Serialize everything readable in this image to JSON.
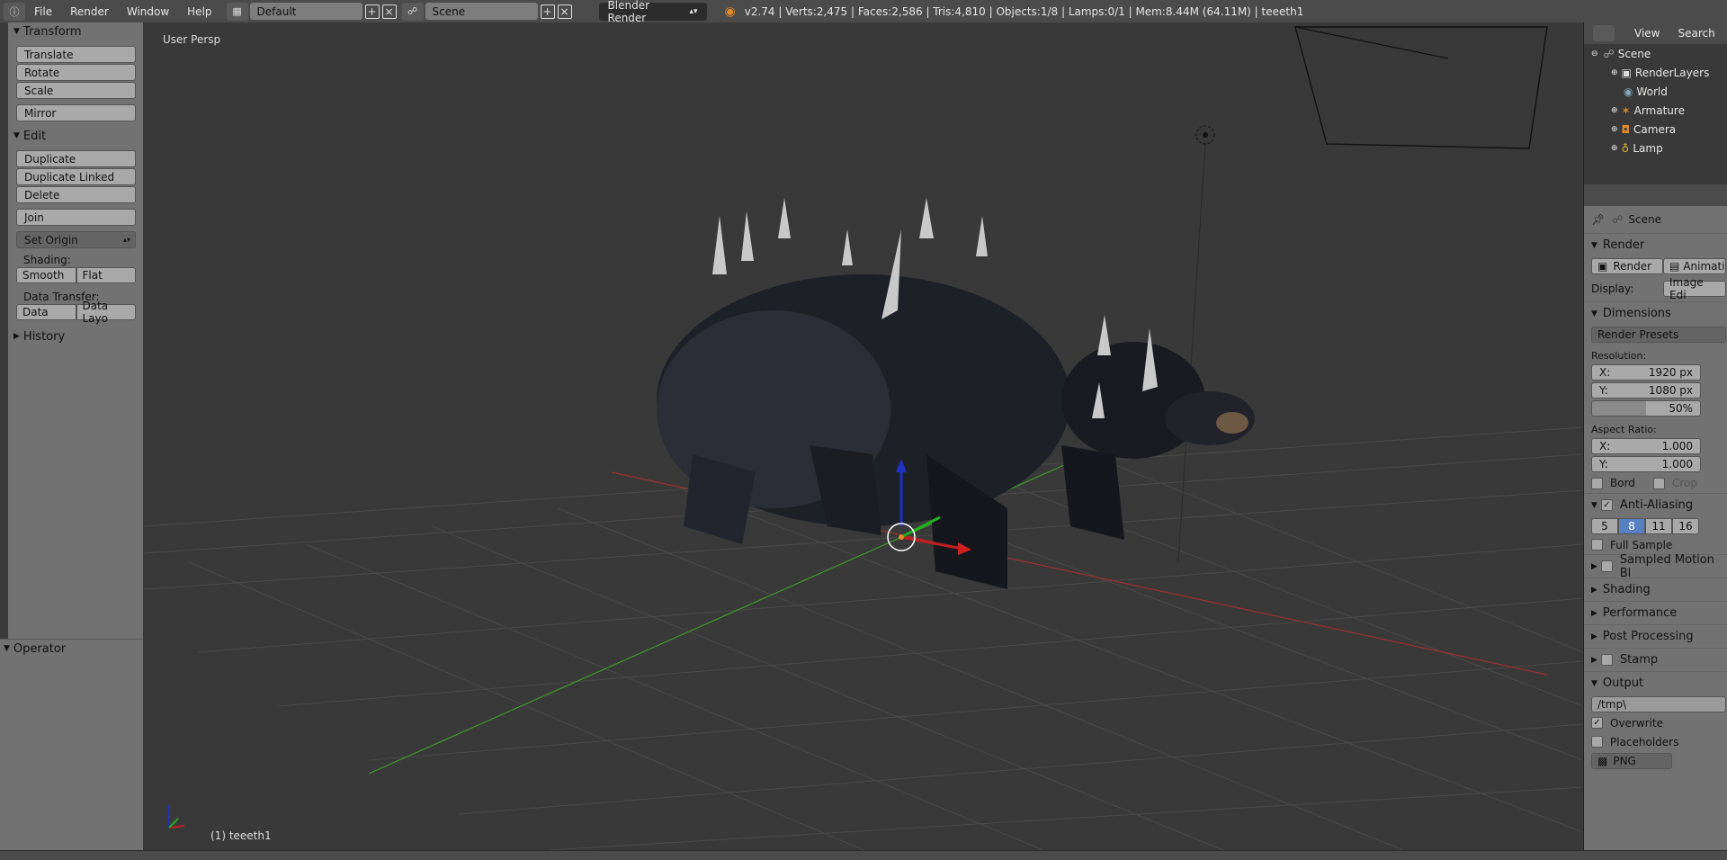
{
  "topbar": {
    "menus": [
      "File",
      "Render",
      "Window",
      "Help"
    ],
    "screen_layout": "Default",
    "scene": "Scene",
    "render_engine": "Blender Render",
    "stats": "v2.74 | Verts:2,475 | Faces:2,586 | Tris:4,810 | Objects:1/8 | Lamps:0/1 | Mem:8.44M (64.11M) | teeeth1"
  },
  "toolshelf": {
    "transform_title": "Transform",
    "translate": "Translate",
    "rotate": "Rotate",
    "scale": "Scale",
    "mirror": "Mirror",
    "edit_title": "Edit",
    "duplicate": "Duplicate",
    "duplicate_linked": "Duplicate Linked",
    "delete": "Delete",
    "join": "Join",
    "set_origin": "Set Origin",
    "shading_label": "Shading:",
    "smooth": "Smooth",
    "flat": "Flat",
    "data_transfer_label": "Data Transfer:",
    "data": "Data",
    "data_layout": "Data Layo",
    "history_title": "History"
  },
  "operator": {
    "title": "Operator"
  },
  "viewport": {
    "view_name": "User Persp",
    "object_label": "(1) teeeth1"
  },
  "outliner": {
    "view": "View",
    "search": "Search",
    "items": [
      "Scene",
      "RenderLayers",
      "World",
      "Armature",
      "Camera",
      "Lamp"
    ]
  },
  "properties": {
    "context": "Scene",
    "render_title": "Render",
    "render_btn": "Render",
    "animation_btn": "Animati",
    "display_label": "Display:",
    "display_value": "Image Edi",
    "dimensions_title": "Dimensions",
    "render_presets": "Render Presets",
    "resolution_label": "Resolution:",
    "res_x_label": "X:",
    "res_x": "1920 px",
    "res_y_label": "Y:",
    "res_y": "1080 px",
    "res_percent": "50%",
    "aspect_label": "Aspect Ratio:",
    "asp_x_label": "X:",
    "asp_x": "1.000",
    "asp_y_label": "Y:",
    "asp_y": "1.000",
    "bord": "Bord",
    "crop": "Crop",
    "antialiasing_title": "Anti-Aliasing",
    "aa_samples": [
      "5",
      "8",
      "11",
      "16"
    ],
    "aa_selected": "8",
    "full_sample": "Full Sample",
    "motion_blur": "Sampled Motion Bl",
    "shading": "Shading",
    "performance": "Performance",
    "post_processing": "Post Processing",
    "stamp": "Stamp",
    "output_title": "Output",
    "output_path": "/tmp\\",
    "overwrite": "Overwrite",
    "placeholders": "Placeholders",
    "file_format": "PNG"
  },
  "colors": {
    "header": "#4b4b4b",
    "panel": "#727272",
    "viewport": "#393939",
    "button": "#a9a9a9",
    "selected": "#5680c2",
    "grid": "#4a4a4a",
    "x_axis": "#a03030",
    "y_axis": "#3f9a2a"
  }
}
